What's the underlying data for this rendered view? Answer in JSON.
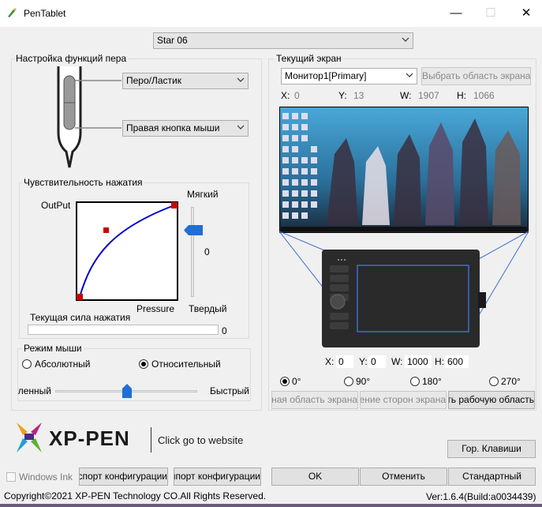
{
  "window": {
    "title": "PenTablet",
    "minimize": "—",
    "maximize": "☐",
    "close": "✕"
  },
  "device": {
    "selected": "Star 06"
  },
  "pen": {
    "group_label": "Настройка функций пера",
    "upper_button": "Перо/Ластик",
    "lower_button": "Правая кнопка мыши"
  },
  "pressure": {
    "group_label": "Чувствительность нажатия",
    "soft_label": "Мягкий",
    "hard_label": "Твердый",
    "output_label": "OutPut",
    "pressure_label": "Pressure",
    "slider_value": "0",
    "current_label": "Текущая сила нажатия",
    "current_value": "0"
  },
  "mouse": {
    "group_label": "Режим мыши",
    "absolute": "Абсолютный",
    "relative": "Относительный",
    "slow": "Медленный",
    "fast": "Быстрый"
  },
  "screen": {
    "group_label": "Текущий экран",
    "monitor": "Монитор1[Primary]",
    "select_area_button": "Выбрать область экрана",
    "x_label": "X:",
    "x_value": "0",
    "y_label": "Y:",
    "y_value": "13",
    "w_label": "W:",
    "w_value": "1907",
    "h_label": "H:",
    "h_value": "1066"
  },
  "tablet": {
    "x_label": "X:",
    "x_value": "0",
    "y_label": "Y:",
    "y_value": "0",
    "w_label": "W:",
    "w_value": "1000",
    "h_label": "H:",
    "h_value": "600",
    "rot0": "0°",
    "rot90": "90°",
    "rot180": "180°",
    "rot270": "270°",
    "full_area_button": "Полная область экрана",
    "aspect_button": "Соотношение сторон экрана",
    "select_work_area_button": "Выбрать рабочую область"
  },
  "brand": {
    "logo_text": "XP-PEN",
    "website_link": "Click go to website"
  },
  "buttons": {
    "hotkeys": "Гор. Клавиши",
    "windows_ink": "Windows Ink",
    "export_config": "Экспорт конфигурации",
    "import_config": "Импорт конфигурации",
    "ok": "OK",
    "cancel": "Отменить",
    "default": "Стандартный"
  },
  "footer": {
    "copyright": "Copyright©2021  XP-PEN Technology CO.All Rights Reserved.",
    "version": "Ver:1.6.4(Build:a0034439)"
  },
  "colors": {
    "curve": "#0000cc",
    "point": "#cc0000",
    "slider_thumb": "#1e6fd6",
    "area_border": "#3a6fc9",
    "tablet_body": "#2a2a2a"
  },
  "icons": {
    "app": "pentablet-app-icon",
    "dropdown": "chevron-down-icon",
    "pen": "pen-illustration",
    "logo": "xp-pen-logo-icon"
  }
}
